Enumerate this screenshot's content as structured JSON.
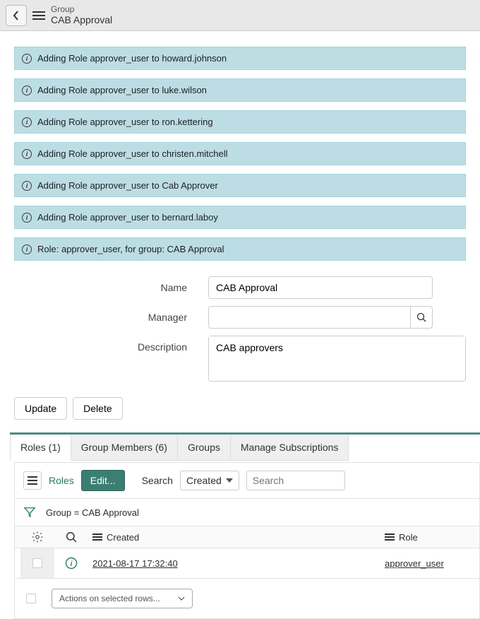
{
  "header": {
    "type": "Group",
    "title": "CAB Approval"
  },
  "alerts": [
    "Adding Role approver_user to howard.johnson",
    "Adding Role approver_user to luke.wilson",
    "Adding Role approver_user to ron.kettering",
    "Adding Role approver_user to christen.mitchell",
    "Adding Role approver_user to Cab Approver",
    "Adding Role approver_user to bernard.laboy",
    "Role: approver_user, for group: CAB Approval"
  ],
  "form": {
    "name": {
      "label": "Name",
      "value": "CAB Approval"
    },
    "manager": {
      "label": "Manager",
      "value": ""
    },
    "description": {
      "label": "Description",
      "value": "CAB approvers"
    }
  },
  "buttons": {
    "update": "Update",
    "delete": "Delete",
    "edit": "Edit..."
  },
  "tabs": [
    {
      "label": "Roles (1)",
      "active": true
    },
    {
      "label": "Group Members (6)",
      "active": false
    },
    {
      "label": "Groups",
      "active": false
    },
    {
      "label": "Manage Subscriptions",
      "active": false
    }
  ],
  "list_toolbar": {
    "roles_label": "Roles",
    "search_label": "Search",
    "select_value": "Created",
    "search_placeholder": "Search"
  },
  "filter_text": "Group = CAB Approval",
  "columns": {
    "created": "Created",
    "role": "Role"
  },
  "row": {
    "created": "2021-08-17 17:32:40",
    "role": "approver_user"
  },
  "footer": {
    "actions_placeholder": "Actions on selected rows..."
  }
}
